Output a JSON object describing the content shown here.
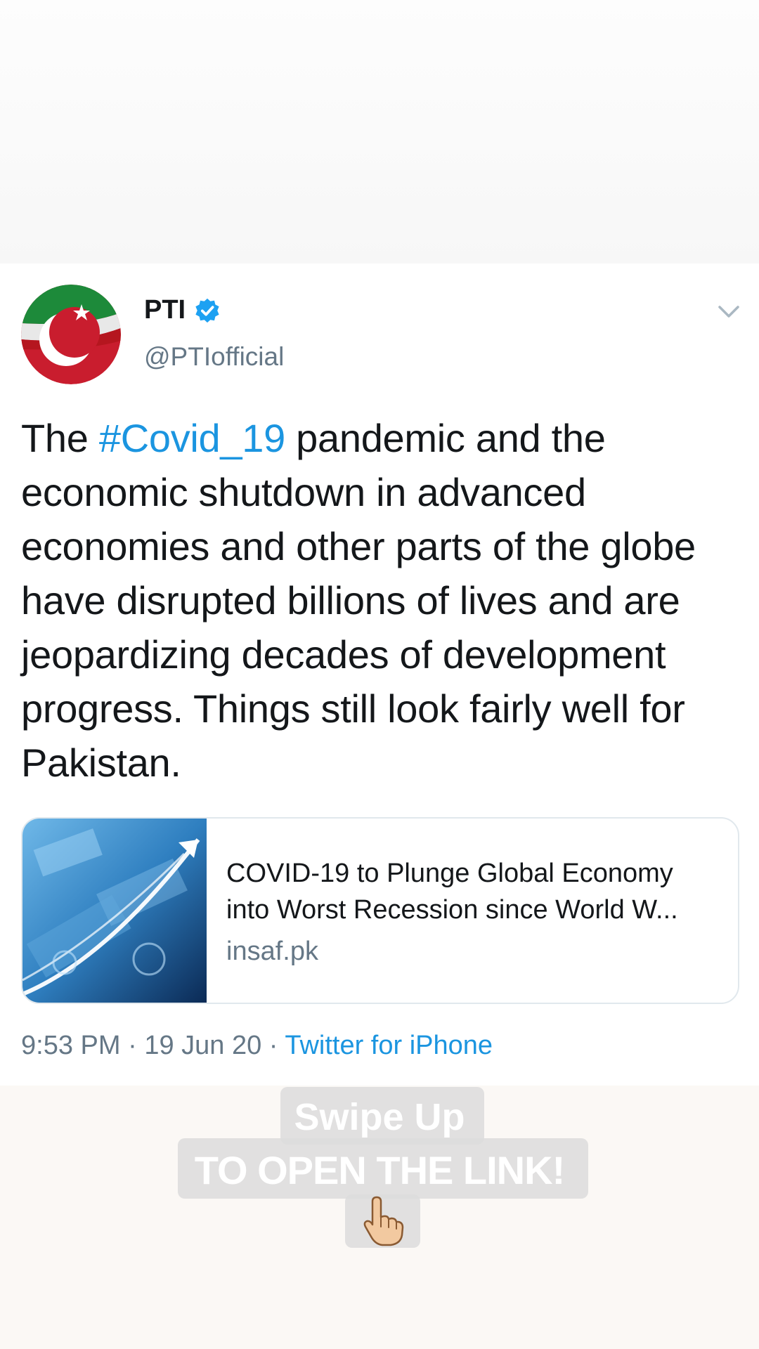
{
  "tweet": {
    "author_name": "PTI",
    "handle": "@PTIofficial",
    "text_before": "The ",
    "hashtag": "#Covid_19",
    "text_after": " pandemic and the economic shutdown in advanced economies and other parts of the globe have disrupted billions of lives and are jeopardizing decades of development progress. Things still look fairly well for Pakistan.",
    "card": {
      "title": "COVID-19 to Plunge Global Economy into Worst Recession since World W...",
      "domain": "insaf.pk"
    },
    "time": "9:53 PM",
    "separator": " · ",
    "date": "19 Jun 20",
    "source": "Twitter for iPhone"
  },
  "story_overlay": {
    "line1": "Swipe Up",
    "line2": "TO OPEN THE LINK!",
    "sticker_icon": "pointing-hand-icon"
  },
  "colors": {
    "link_blue": "#1b95e0",
    "text_dark": "#14171a",
    "text_grey": "#657786",
    "verified_blue": "#1da1f2"
  }
}
